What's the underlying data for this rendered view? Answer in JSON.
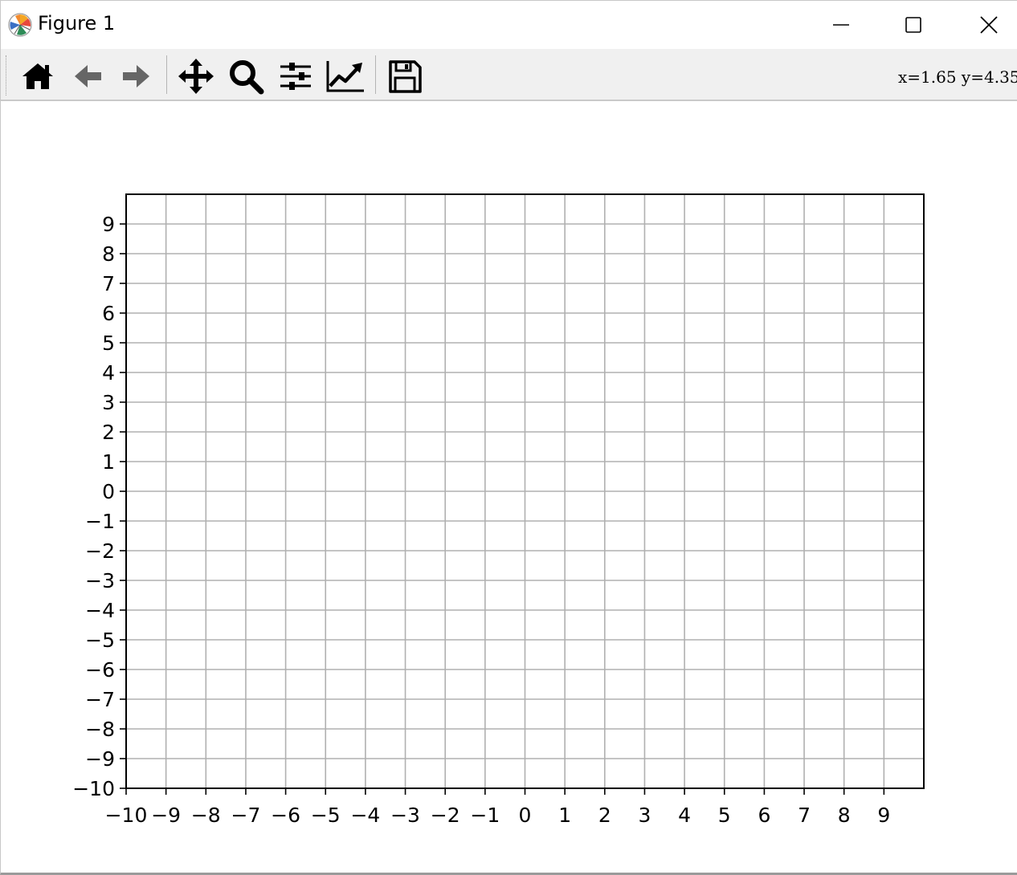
{
  "window": {
    "title": "Figure 1",
    "logo_icon": "matplotlib-logo-icon",
    "controls": [
      "minimize-icon",
      "maximize-icon",
      "close-icon"
    ]
  },
  "toolbar": {
    "buttons": [
      {
        "name": "home-button",
        "icon": "home-icon"
      },
      {
        "name": "back-button",
        "icon": "arrow-left-icon"
      },
      {
        "name": "forward-button",
        "icon": "arrow-right-icon"
      },
      {
        "name": "pan-button",
        "icon": "move-arrows-icon"
      },
      {
        "name": "zoom-button",
        "icon": "magnifier-icon"
      },
      {
        "name": "configure-subplots-button",
        "icon": "sliders-icon"
      },
      {
        "name": "edit-axes-button",
        "icon": "line-chart-icon"
      },
      {
        "name": "save-button",
        "icon": "floppy-disk-icon"
      }
    ],
    "coordinates": "x=1.65 y=4.35"
  },
  "chart_data": {
    "type": "line",
    "series": [],
    "xlim": [
      -10,
      10
    ],
    "ylim": [
      -10,
      10
    ],
    "x_ticks": [
      -10,
      -9,
      -8,
      -7,
      -6,
      -5,
      -4,
      -3,
      -2,
      -1,
      0,
      1,
      2,
      3,
      4,
      5,
      6,
      7,
      8,
      9
    ],
    "y_ticks": [
      -10,
      -9,
      -8,
      -7,
      -6,
      -5,
      -4,
      -3,
      -2,
      -1,
      0,
      1,
      2,
      3,
      4,
      5,
      6,
      7,
      8,
      9
    ],
    "x_tick_labels": [
      "−10",
      "−9",
      "−8",
      "−7",
      "−6",
      "−5",
      "−4",
      "−3",
      "−2",
      "−1",
      "0",
      "1",
      "2",
      "3",
      "4",
      "5",
      "6",
      "7",
      "8",
      "9"
    ],
    "y_tick_labels": [
      "−10",
      "−9",
      "−8",
      "−7",
      "−6",
      "−5",
      "−4",
      "−3",
      "−2",
      "−1",
      "0",
      "1",
      "2",
      "3",
      "4",
      "5",
      "6",
      "7",
      "8",
      "9"
    ],
    "grid": true,
    "grid_color": "#b0b0b0",
    "title": "",
    "xlabel": "",
    "ylabel": ""
  }
}
